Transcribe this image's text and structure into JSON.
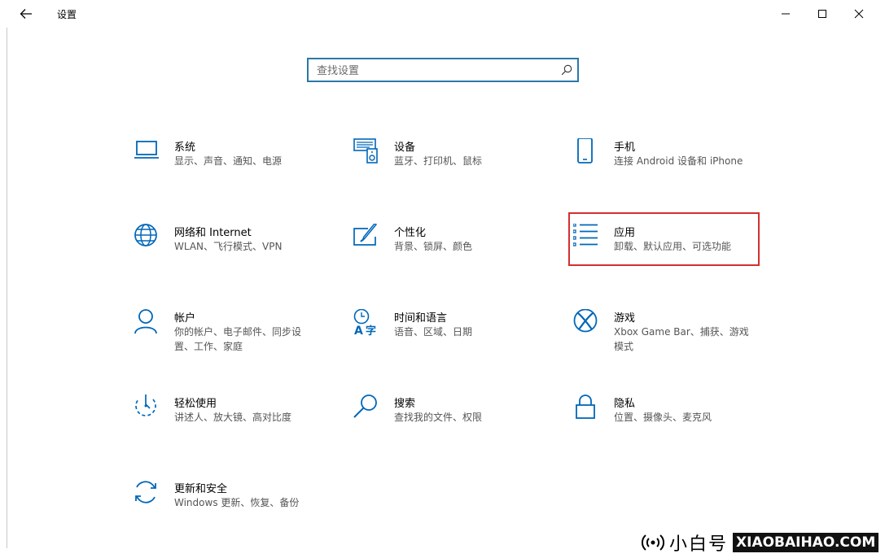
{
  "window": {
    "title": "设置",
    "controls": [
      "minimize",
      "maximize",
      "close"
    ]
  },
  "search": {
    "placeholder": "查找设置",
    "value": ""
  },
  "categories": [
    {
      "name": "系统",
      "desc": "显示、声音、通知、电源",
      "icon": "laptop-icon"
    },
    {
      "name": "设备",
      "desc": "蓝牙、打印机、鼠标",
      "icon": "devices-icon"
    },
    {
      "name": "手机",
      "desc": "连接 Android 设备和 iPhone",
      "icon": "phone-icon"
    },
    {
      "name": "网络和 Internet",
      "desc": "WLAN、飞行模式、VPN",
      "icon": "globe-icon"
    },
    {
      "name": "个性化",
      "desc": "背景、锁屏、颜色",
      "icon": "paint-icon"
    },
    {
      "name": "应用",
      "desc": "卸载、默认应用、可选功能",
      "icon": "apps-list-icon",
      "highlighted": true
    },
    {
      "name": "帐户",
      "desc": "你的帐户、电子邮件、同步设置、工作、家庭",
      "icon": "person-icon"
    },
    {
      "name": "时间和语言",
      "desc": "语音、区域、日期",
      "icon": "time-language-icon"
    },
    {
      "name": "游戏",
      "desc": "Xbox Game Bar、捕获、游戏模式",
      "icon": "xbox-icon"
    },
    {
      "name": "轻松使用",
      "desc": "讲述人、放大镜、高对比度",
      "icon": "ease-of-access-icon"
    },
    {
      "name": "搜索",
      "desc": "查找我的文件、权限",
      "icon": "search-magnifier-icon"
    },
    {
      "name": "隐私",
      "desc": "位置、摄像头、麦克风",
      "icon": "lock-icon"
    },
    {
      "name": "更新和安全",
      "desc": "Windows 更新、恢复、备份",
      "icon": "sync-icon"
    }
  ],
  "watermark": {
    "cn": "小白号",
    "en": "XIAOBAIHAO.COM"
  },
  "colors": {
    "accent": "#0067b8",
    "highlight": "#d32f2f",
    "search_border": "#2b78a8"
  }
}
